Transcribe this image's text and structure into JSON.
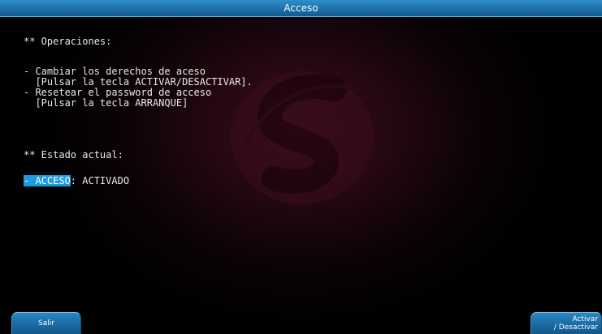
{
  "window": {
    "title": "Acceso"
  },
  "content": {
    "operaciones_heading": "** Operaciones:",
    "op1_line1": "- Cambiar los derechos de aceso",
    "op1_line2": "  [Pulsar la tecla ACTIVAR/DESACTIVAR].",
    "op2_line1": "- Resetear el password de acceso",
    "op2_line2": "  [Pulsar la tecla ARRANQUE]",
    "estado_heading": "** Estado actual:",
    "acceso_label": "- ACCESO",
    "acceso_separator": ":",
    "acceso_value": " ACTIVADO"
  },
  "softkeys": {
    "left_label": "Salir",
    "right_label_line1": "Activar",
    "right_label_line2": "/ Desactivar"
  },
  "colors": {
    "title_bar": "#1a6ea8",
    "highlight": "#1e9be0",
    "background": "#230712"
  }
}
